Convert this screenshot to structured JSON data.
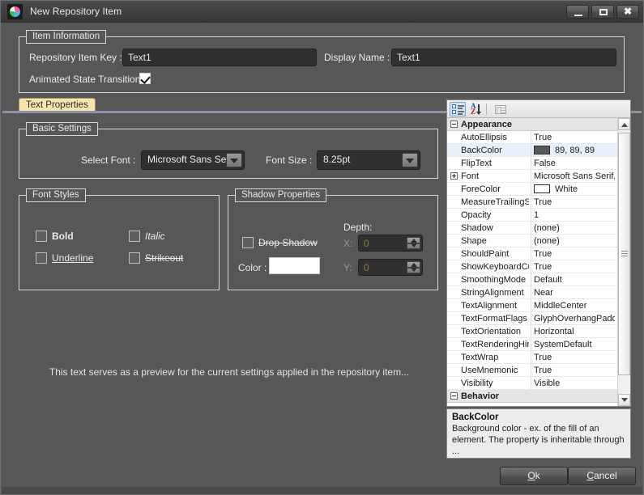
{
  "window": {
    "title": "New Repository Item",
    "icon": "app-palette-icon",
    "controls": {
      "minimize": "minimize-icon",
      "maximize": "maximize-icon",
      "close": "close-icon"
    }
  },
  "item_information": {
    "legend": "Item Information",
    "repository_item_key_label": "Repository Item Key :",
    "repository_item_key_value": "Text1",
    "display_name_label": "Display Name :",
    "display_name_value": "Text1",
    "animated_state_transition_label": "Animated State Transition",
    "animated_state_transition_checked": true
  },
  "tabs": [
    {
      "label": "Text Properties",
      "selected": true
    }
  ],
  "basic_settings": {
    "legend": "Basic Settings",
    "select_font_label": "Select Font :",
    "select_font_value": "Microsoft Sans Serif",
    "font_size_label": "Font Size :",
    "font_size_value": "8.25pt"
  },
  "font_styles": {
    "legend": "Font Styles",
    "items": [
      {
        "label": "Bold",
        "checked": false,
        "style": "bold"
      },
      {
        "label": "Italic",
        "checked": false,
        "style": "italic"
      },
      {
        "label": "Underline",
        "checked": false,
        "style": "underline"
      },
      {
        "label": "Strikeout",
        "checked": false,
        "style": "strikeout"
      }
    ]
  },
  "shadow_properties": {
    "legend": "Shadow Properties",
    "drop_shadow_label": "Drop Shadow",
    "drop_shadow_checked": false,
    "color_label": "Color :",
    "color_value": "#FFFFFF",
    "depth_label": "Depth:",
    "x_label": "X:",
    "x_value": "0",
    "y_label": "Y:",
    "y_value": "0"
  },
  "preview": {
    "text": "This text serves as a preview for the current settings applied in the repository item..."
  },
  "property_grid": {
    "toolbar": [
      {
        "name": "categorized-view-button",
        "pressed": true
      },
      {
        "name": "alphabetical-sort-button",
        "pressed": false
      },
      {
        "name": "property-pages-button",
        "disabled": true
      }
    ],
    "rows": [
      {
        "kind": "category",
        "name": "Appearance",
        "expander": "minus"
      },
      {
        "kind": "prop",
        "name": "AutoEllipsis",
        "value": "True"
      },
      {
        "kind": "prop",
        "name": "BackColor",
        "value": "89, 89, 89",
        "swatch": "#595959",
        "selected": true
      },
      {
        "kind": "prop",
        "name": "FlipText",
        "value": "False"
      },
      {
        "kind": "prop",
        "name": "Font",
        "value": "Microsoft Sans Serif, ",
        "expander": "plus"
      },
      {
        "kind": "prop",
        "name": "ForeColor",
        "value": "White",
        "swatch": "#FFFFFF"
      },
      {
        "kind": "prop",
        "name": "MeasureTrailingSp",
        "value": "True"
      },
      {
        "kind": "prop",
        "name": "Opacity",
        "value": "1"
      },
      {
        "kind": "prop",
        "name": "Shadow",
        "value": "(none)"
      },
      {
        "kind": "prop",
        "name": "Shape",
        "value": "(none)"
      },
      {
        "kind": "prop",
        "name": "ShouldPaint",
        "value": "True"
      },
      {
        "kind": "prop",
        "name": "ShowKeyboardCu",
        "value": "True"
      },
      {
        "kind": "prop",
        "name": "SmoothingMode",
        "value": "Default"
      },
      {
        "kind": "prop",
        "name": "StringAlignment",
        "value": "Near"
      },
      {
        "kind": "prop",
        "name": "TextAlignment",
        "value": "MiddleCenter"
      },
      {
        "kind": "prop",
        "name": "TextFormatFlags",
        "value": "GlyphOverhangPaddi"
      },
      {
        "kind": "prop",
        "name": "TextOrientation",
        "value": "Horizontal"
      },
      {
        "kind": "prop",
        "name": "TextRenderingHin",
        "value": "SystemDefault"
      },
      {
        "kind": "prop",
        "name": "TextWrap",
        "value": "True"
      },
      {
        "kind": "prop",
        "name": "UseMnemonic",
        "value": "True"
      },
      {
        "kind": "prop",
        "name": "Visibility",
        "value": "Visible"
      },
      {
        "kind": "category",
        "name": "Behavior",
        "expander": "minus"
      }
    ]
  },
  "description": {
    "title": "BackColor",
    "body": "Background color - ex. of the fill of an element. The property is inheritable through ..."
  },
  "footer": {
    "ok_label": "Ok",
    "ok_mnemonic": "O",
    "cancel_label": "Cancel",
    "cancel_mnemonic": "C"
  }
}
